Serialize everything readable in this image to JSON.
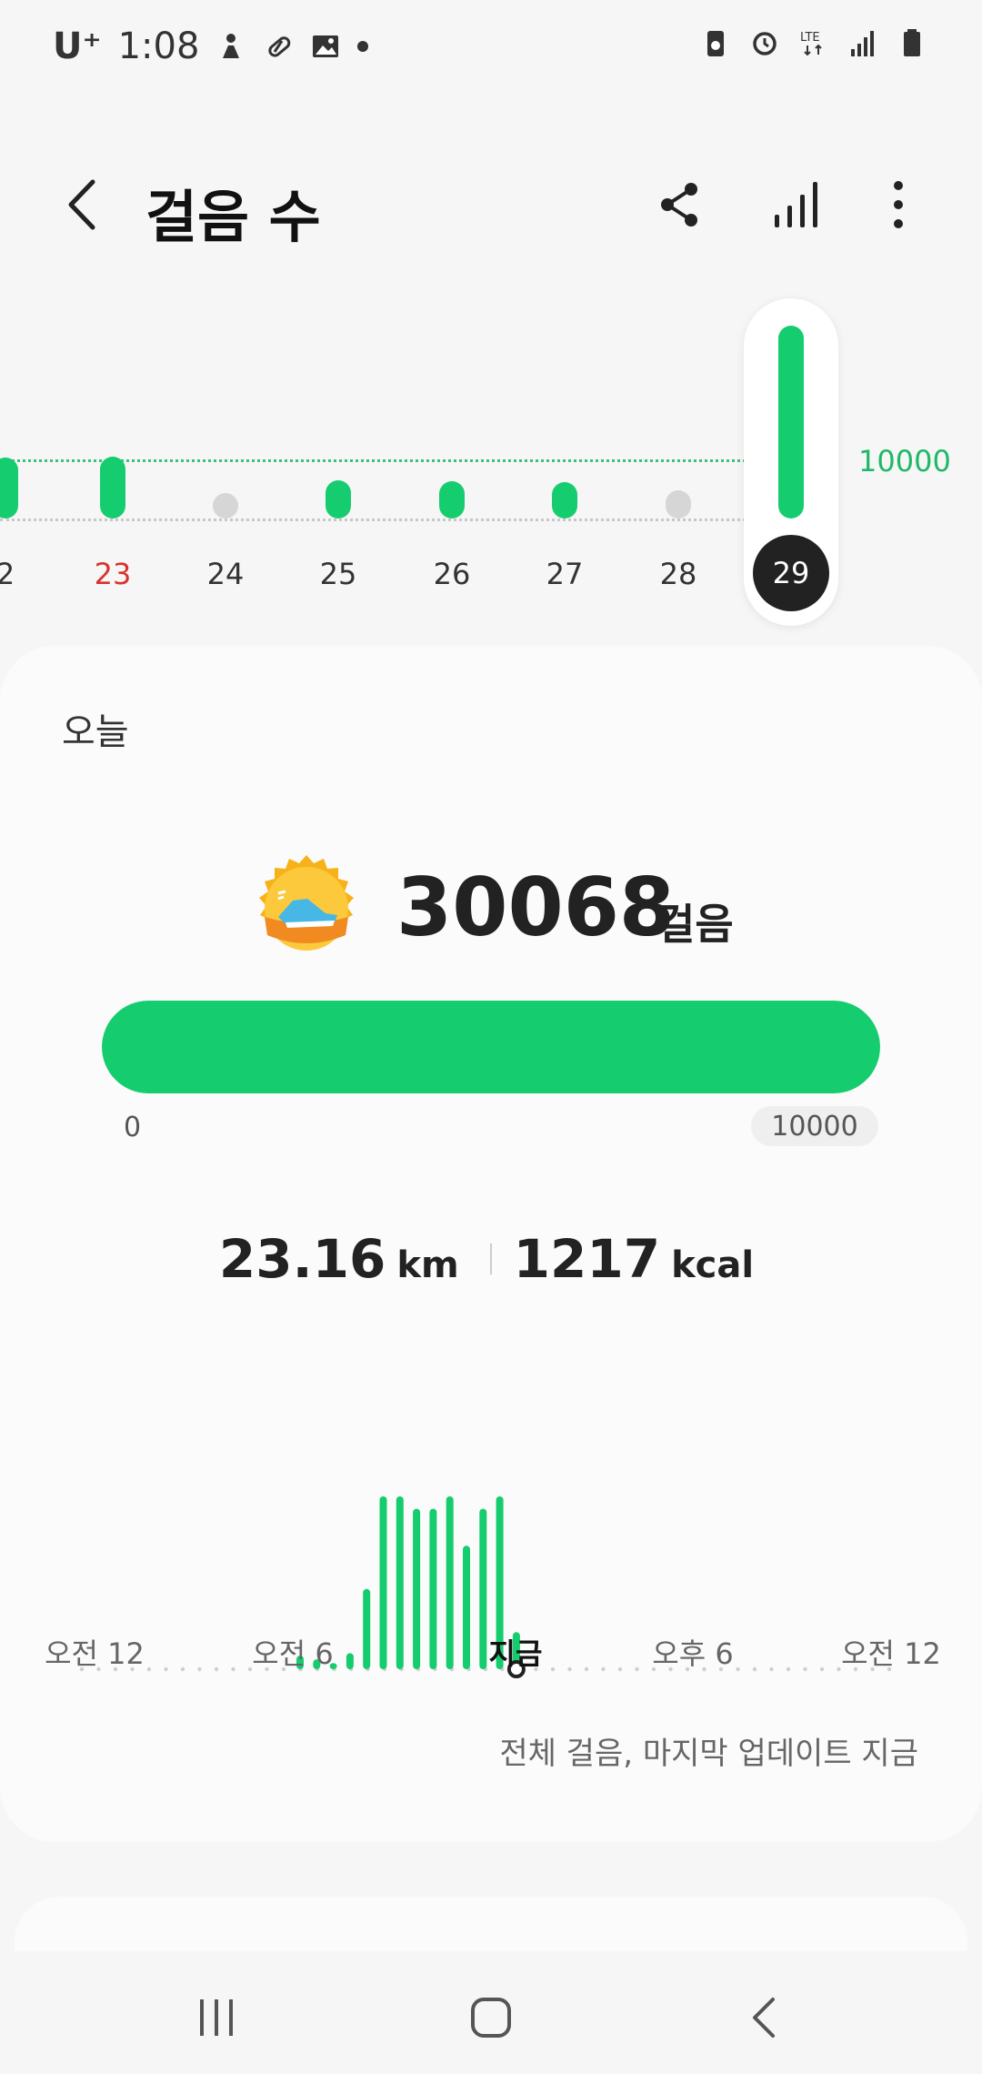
{
  "status": {
    "carrier": "U⁺",
    "time": "1:08"
  },
  "header": {
    "title": "걸음 수"
  },
  "week": {
    "goal_label": "10000",
    "days": [
      {
        "label": "2",
        "steps": 10300,
        "active": true,
        "red": false
      },
      {
        "label": "23",
        "steps": 10400,
        "active": true,
        "red": true
      },
      {
        "label": "24",
        "steps": 2600,
        "active": false,
        "red": false
      },
      {
        "label": "25",
        "steps": 6500,
        "active": true,
        "red": false
      },
      {
        "label": "26",
        "steps": 6300,
        "active": true,
        "red": false
      },
      {
        "label": "27",
        "steps": 6200,
        "active": true,
        "red": false
      },
      {
        "label": "28",
        "steps": 4800,
        "active": false,
        "red": false
      },
      {
        "label": "29",
        "steps": 30068,
        "active": true,
        "red": false,
        "selected": true
      }
    ]
  },
  "today": {
    "label": "오늘",
    "steps": "30068",
    "unit": "걸음",
    "progress_fraction": 1.0,
    "progress_min": "0",
    "progress_max": "10000",
    "distance": "23.16",
    "distance_unit": "km",
    "calories": "1217",
    "calories_unit": "kcal"
  },
  "hourly": {
    "labels": [
      "오전 12",
      "오전 6",
      "지금",
      "오후 6",
      "오전 12"
    ],
    "bars": [
      0,
      0,
      0,
      0,
      0,
      0,
      0,
      0,
      0,
      0,
      0,
      0,
      0,
      220,
      160,
      100,
      260,
      1300,
      2800,
      2800,
      2600,
      2600,
      2800,
      2000,
      2600,
      2800,
      600
    ],
    "note": "전체 걸음, 마지막 업데이트 지금"
  },
  "colors": {
    "accent": "#15cd6e",
    "inactive": "#d6d6d6",
    "red_day": "#d8332e"
  }
}
